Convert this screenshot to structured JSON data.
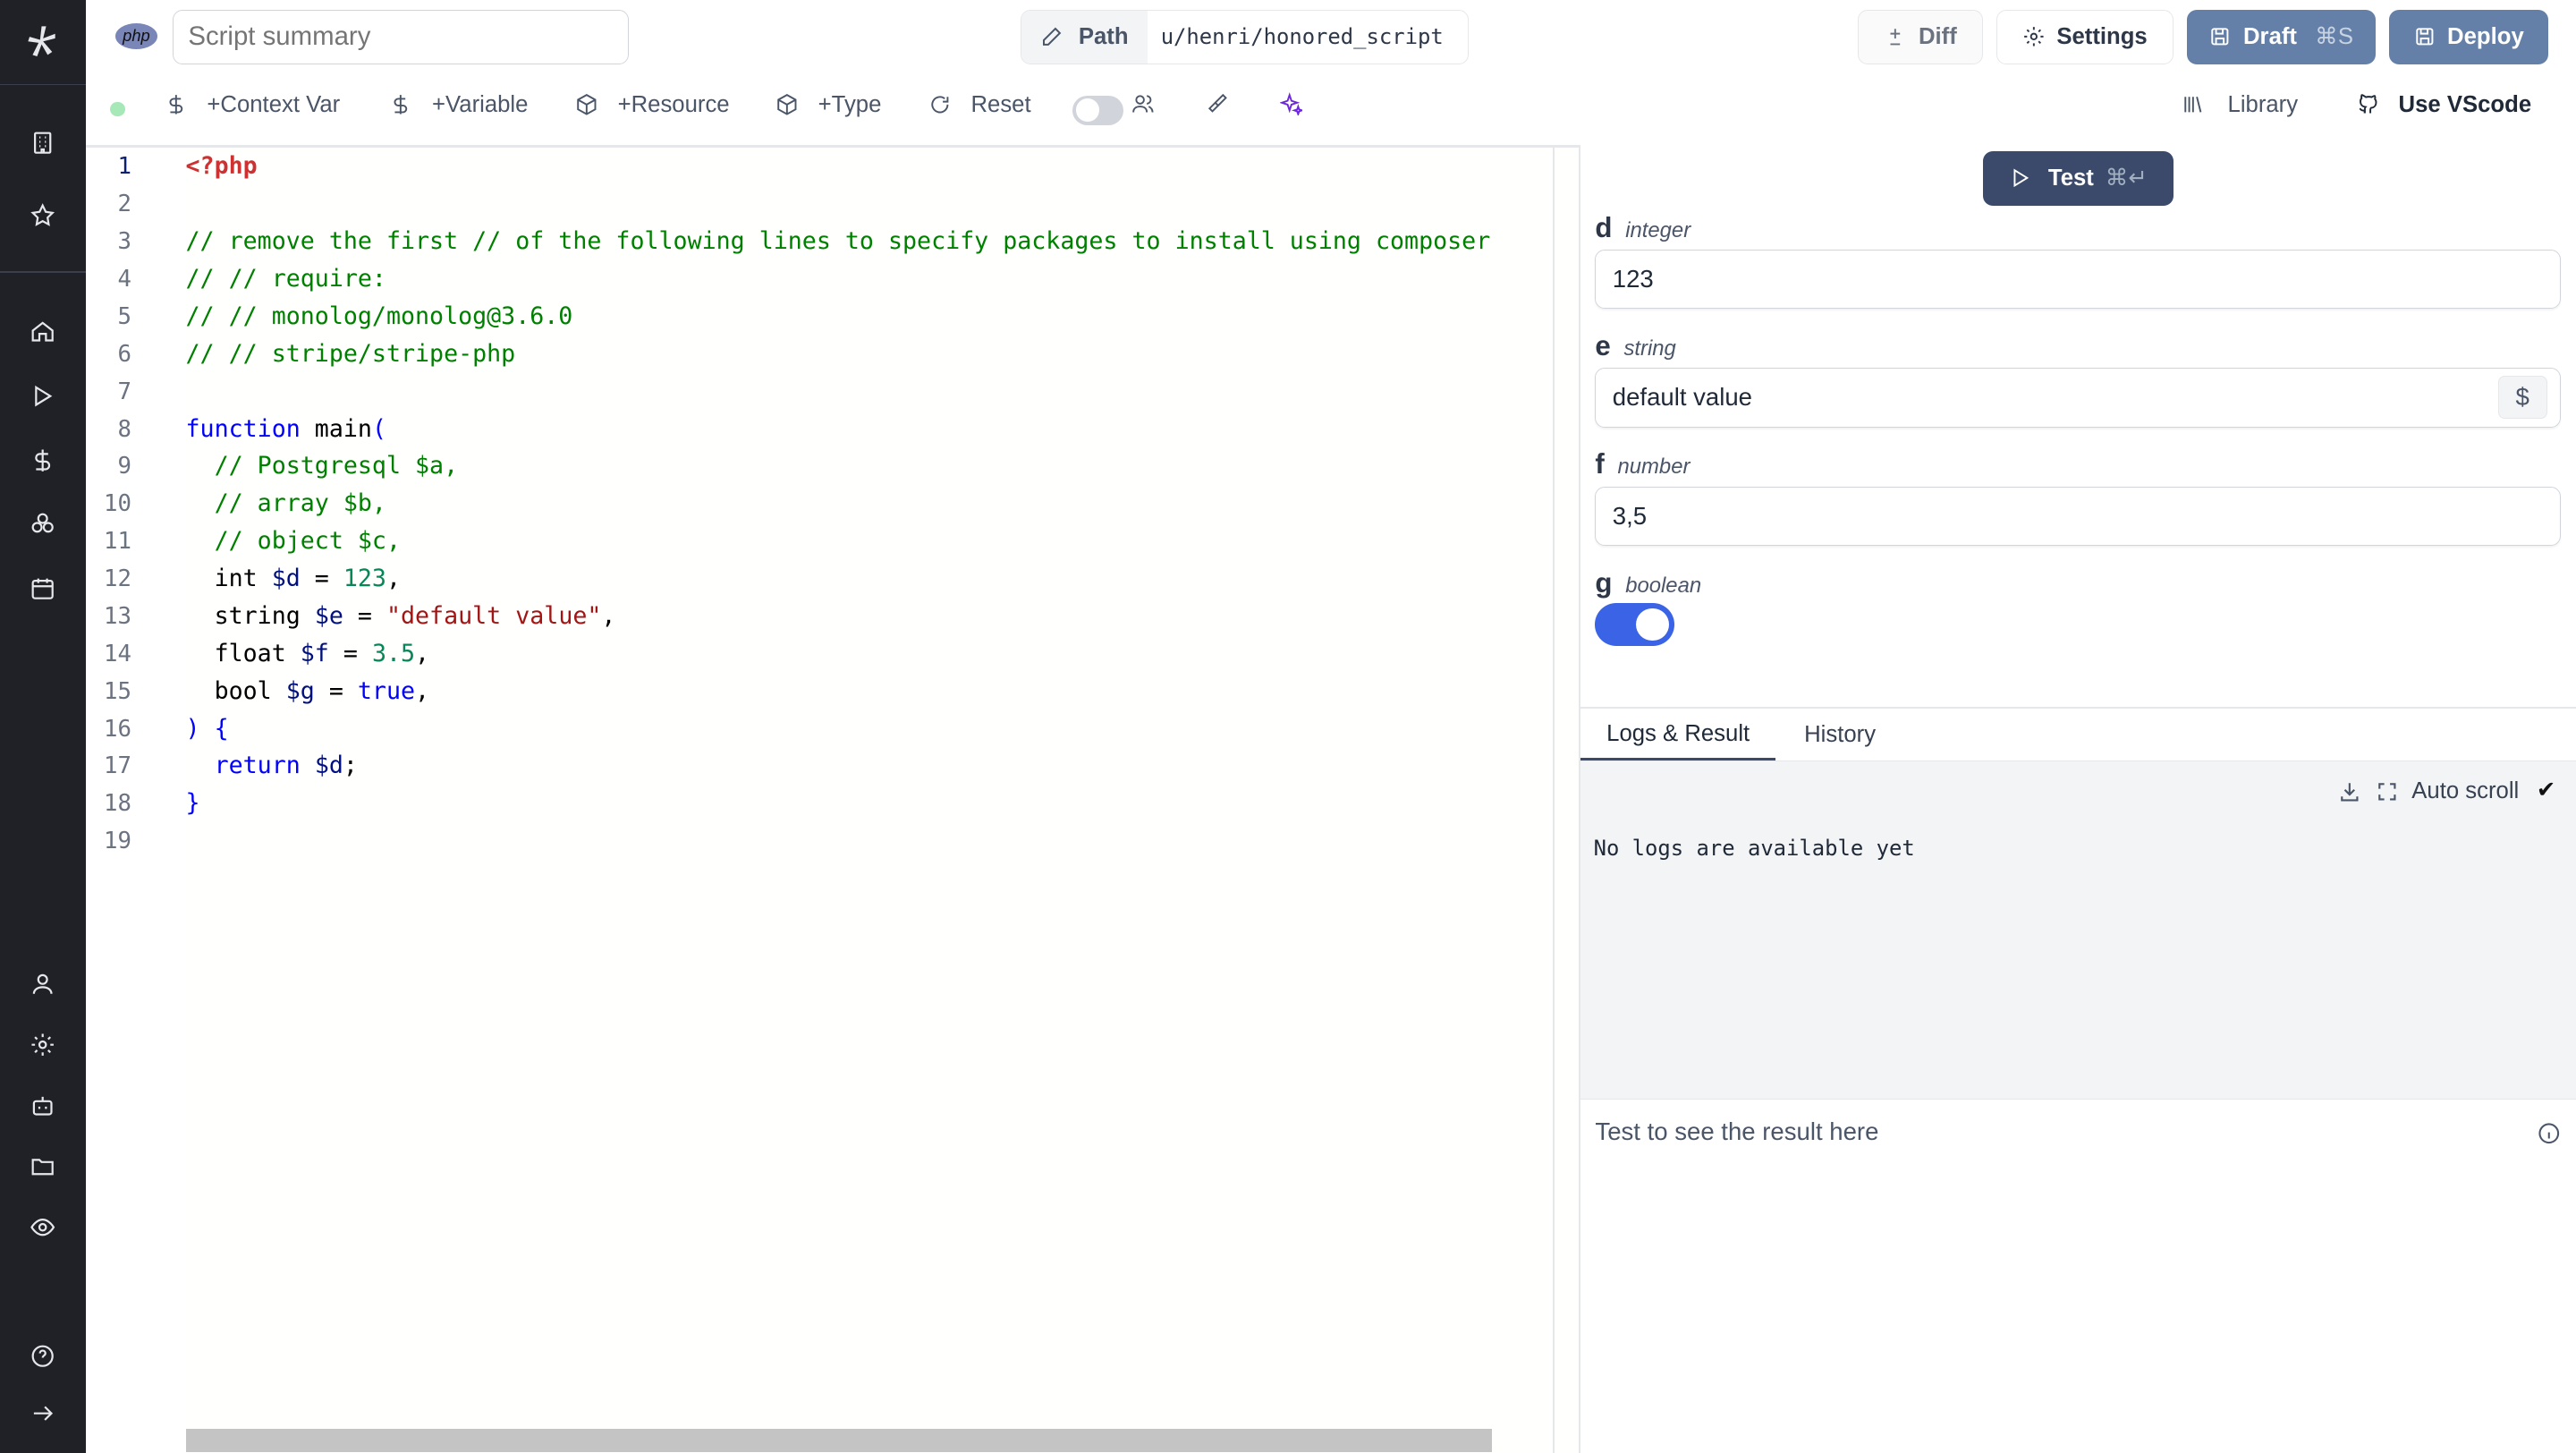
{
  "header": {
    "language_badge": "php",
    "summary_placeholder": "Script summary",
    "path_label": "Path",
    "path_value": "u/henri/honored_script",
    "diff_label": "Diff",
    "settings_label": "Settings",
    "draft_label": "Draft",
    "draft_shortcut": "⌘S",
    "deploy_label": "Deploy"
  },
  "toolbar": {
    "context_var": "+Context Var",
    "variable": "+Variable",
    "resource": "+Resource",
    "type": "+Type",
    "reset": "Reset",
    "library": "Library",
    "use_vscode": "Use VScode",
    "status_color": "#a7e8b8"
  },
  "editor": {
    "lines": [
      [
        [
          "<?php",
          "tag"
        ]
      ],
      [],
      [
        [
          "// remove the first // of the following lines to specify packages to install using composer",
          "cm"
        ]
      ],
      [
        [
          "// // require:",
          "cm"
        ]
      ],
      [
        [
          "// // monolog/monolog@3.6.0",
          "cm"
        ]
      ],
      [
        [
          "// // stripe/stripe-php",
          "cm"
        ]
      ],
      [],
      [
        [
          "function",
          "kw"
        ],
        [
          " main",
          "pl"
        ],
        [
          "(",
          "kw"
        ]
      ],
      [
        [
          "  // Postgresql $a,",
          "cm"
        ]
      ],
      [
        [
          "  // array $b,",
          "cm"
        ]
      ],
      [
        [
          "  // object $c,",
          "cm"
        ]
      ],
      [
        [
          "  int ",
          "pl"
        ],
        [
          "$d",
          "var"
        ],
        [
          " = ",
          "pl"
        ],
        [
          "123",
          "num"
        ],
        [
          ",",
          "pl"
        ]
      ],
      [
        [
          "  string ",
          "pl"
        ],
        [
          "$e",
          "var"
        ],
        [
          " = ",
          "pl"
        ],
        [
          "\"default value\"",
          "str"
        ],
        [
          ",",
          "pl"
        ]
      ],
      [
        [
          "  float ",
          "pl"
        ],
        [
          "$f",
          "var"
        ],
        [
          " = ",
          "pl"
        ],
        [
          "3.5",
          "num"
        ],
        [
          ",",
          "pl"
        ]
      ],
      [
        [
          "  bool ",
          "pl"
        ],
        [
          "$g",
          "var"
        ],
        [
          " = ",
          "pl"
        ],
        [
          "true",
          "kw"
        ],
        [
          ",",
          "pl"
        ]
      ],
      [
        [
          ") {",
          "kw"
        ]
      ],
      [
        [
          "  return ",
          "kw"
        ],
        [
          "$d",
          "var"
        ],
        [
          ";",
          "pl"
        ]
      ],
      [
        [
          "}",
          "kw"
        ]
      ],
      []
    ]
  },
  "test_panel": {
    "test_label": "Test",
    "test_shortcut": "⌘↵",
    "fields": [
      {
        "name": "d",
        "type": "integer",
        "value": "123"
      },
      {
        "name": "e",
        "type": "string",
        "value": "default value"
      },
      {
        "name": "f",
        "type": "number",
        "value": "3,5"
      },
      {
        "name": "g",
        "type": "boolean",
        "value": true
      }
    ],
    "tabs": [
      "Logs & Result",
      "History"
    ],
    "active_tab": "Logs & Result",
    "auto_scroll": "Auto scroll",
    "no_logs": "No logs are available yet",
    "result_placeholder": "Test to see the result here"
  },
  "colors": {
    "sidebar": "#1f2127",
    "primary": "#3b4a6b",
    "draft": "#6580a8",
    "toggle_on": "#3b63e6"
  }
}
